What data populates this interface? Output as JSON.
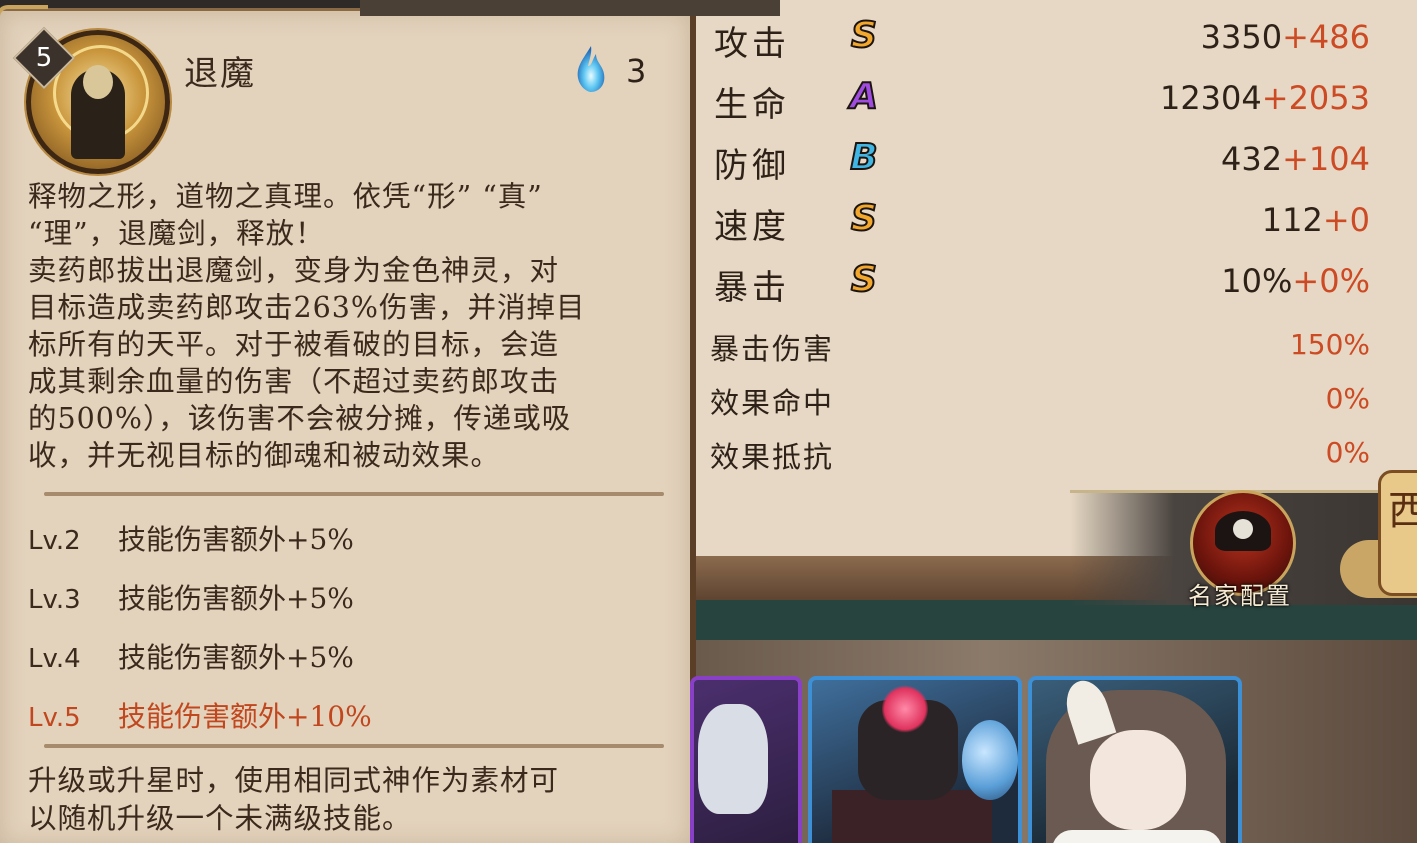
{
  "skill": {
    "level": "5",
    "name": "退魔",
    "cost": "3",
    "description": "释物之形，道物之真理。依凭“形” “真”\n“理”，退魔剑，释放！\n卖药郎拔出退魔剑，变身为金色神灵，对\n目标造成卖药郎攻击263%伤害，并消掉目\n标所有的天平。对于被看破的目标，会造\n成其剩余血量的伤害（不超过卖药郎攻击\n的500%），该伤害不会被分摊，传递或吸\n收，并无视目标的御魂和被动效果。",
    "upgrades": [
      {
        "level": "Lv.2",
        "effect": "技能伤害额外+5%"
      },
      {
        "level": "Lv.3",
        "effect": "技能伤害额外+5%"
      },
      {
        "level": "Lv.4",
        "effect": "技能伤害额外+5%"
      },
      {
        "level": "Lv.5",
        "effect": "技能伤害额外+10%"
      }
    ],
    "upgrade_note": "升级或升星时，使用相同式神作为素材可\n以随机升级一个未满级技能。"
  },
  "stats": {
    "main": [
      {
        "label": "攻击",
        "grade": "S",
        "base": "3350",
        "bonus": "+486"
      },
      {
        "label": "生命",
        "grade": "A",
        "base": "12304",
        "bonus": "+2053"
      },
      {
        "label": "防御",
        "grade": "B",
        "base": "432",
        "bonus": "+104"
      },
      {
        "label": "速度",
        "grade": "S",
        "base": "112",
        "bonus": "+0"
      },
      {
        "label": "暴击",
        "grade": "S",
        "base": "10%",
        "bonus": "+0%"
      }
    ],
    "secondary": [
      {
        "label": "暴击伤害",
        "value": "150%"
      },
      {
        "label": "效果命中",
        "value": "0%"
      },
      {
        "label": "效果抵抗",
        "value": "0%"
      }
    ]
  },
  "master_config": {
    "label": "名家配置"
  },
  "side_tab": {
    "glyph": "西"
  },
  "colors": {
    "panel_bg": "#e3d2bc",
    "text_dark": "#3b2a1c",
    "bonus_red": "#cc4a24",
    "grade_s": "#f2a72d",
    "grade_a": "#a04ce0",
    "grade_b": "#3fb6e3"
  },
  "icons": {
    "cost": "blue-soul-flame-icon",
    "skill": "exorcism-sword-skill-icon"
  }
}
